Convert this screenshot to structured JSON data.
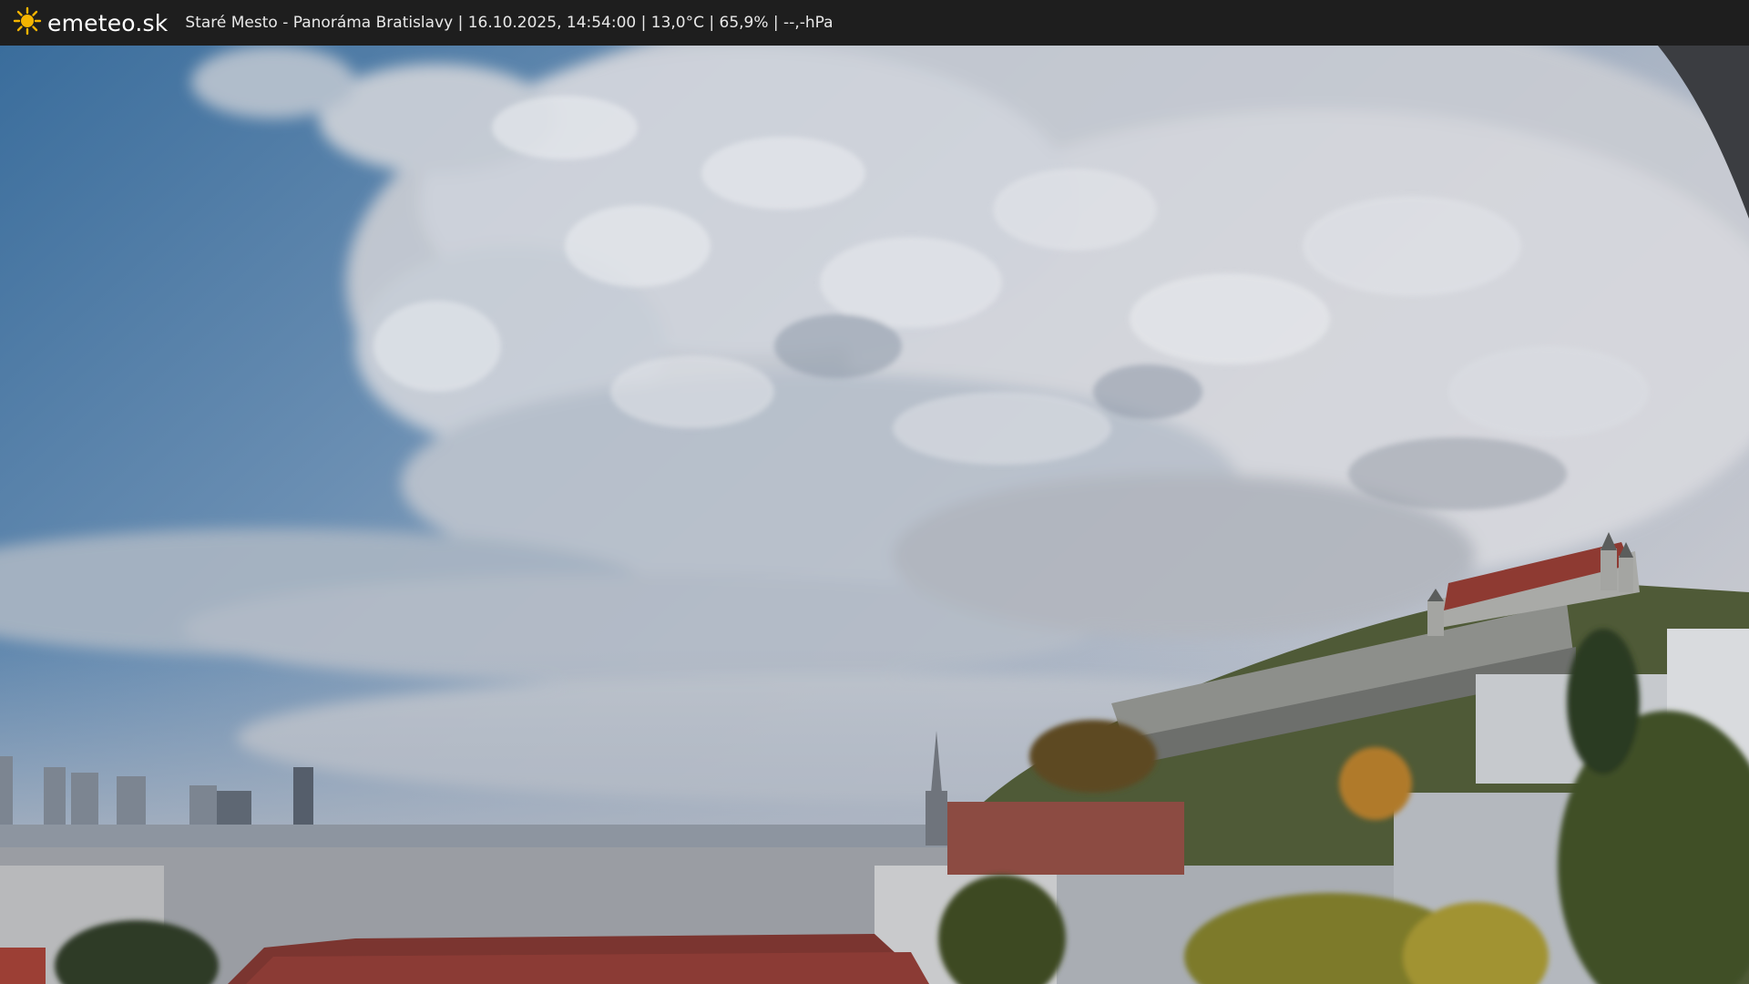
{
  "header": {
    "brand": "emeteo.sk",
    "caption": "Staré Mesto - Panoráma Bratislavy | 16.10.2025, 14:54:00 | 13,0°C | 65,9% | --,-hPa"
  },
  "logo": {
    "icon": "sun-icon",
    "color": "#f4b400"
  },
  "colors": {
    "bar": "#1e1e1e",
    "sky_top": "#3d6f9e",
    "cloud": "#d9dadf",
    "roof": "#9b3a33",
    "foliage": "#5f6b2a"
  }
}
